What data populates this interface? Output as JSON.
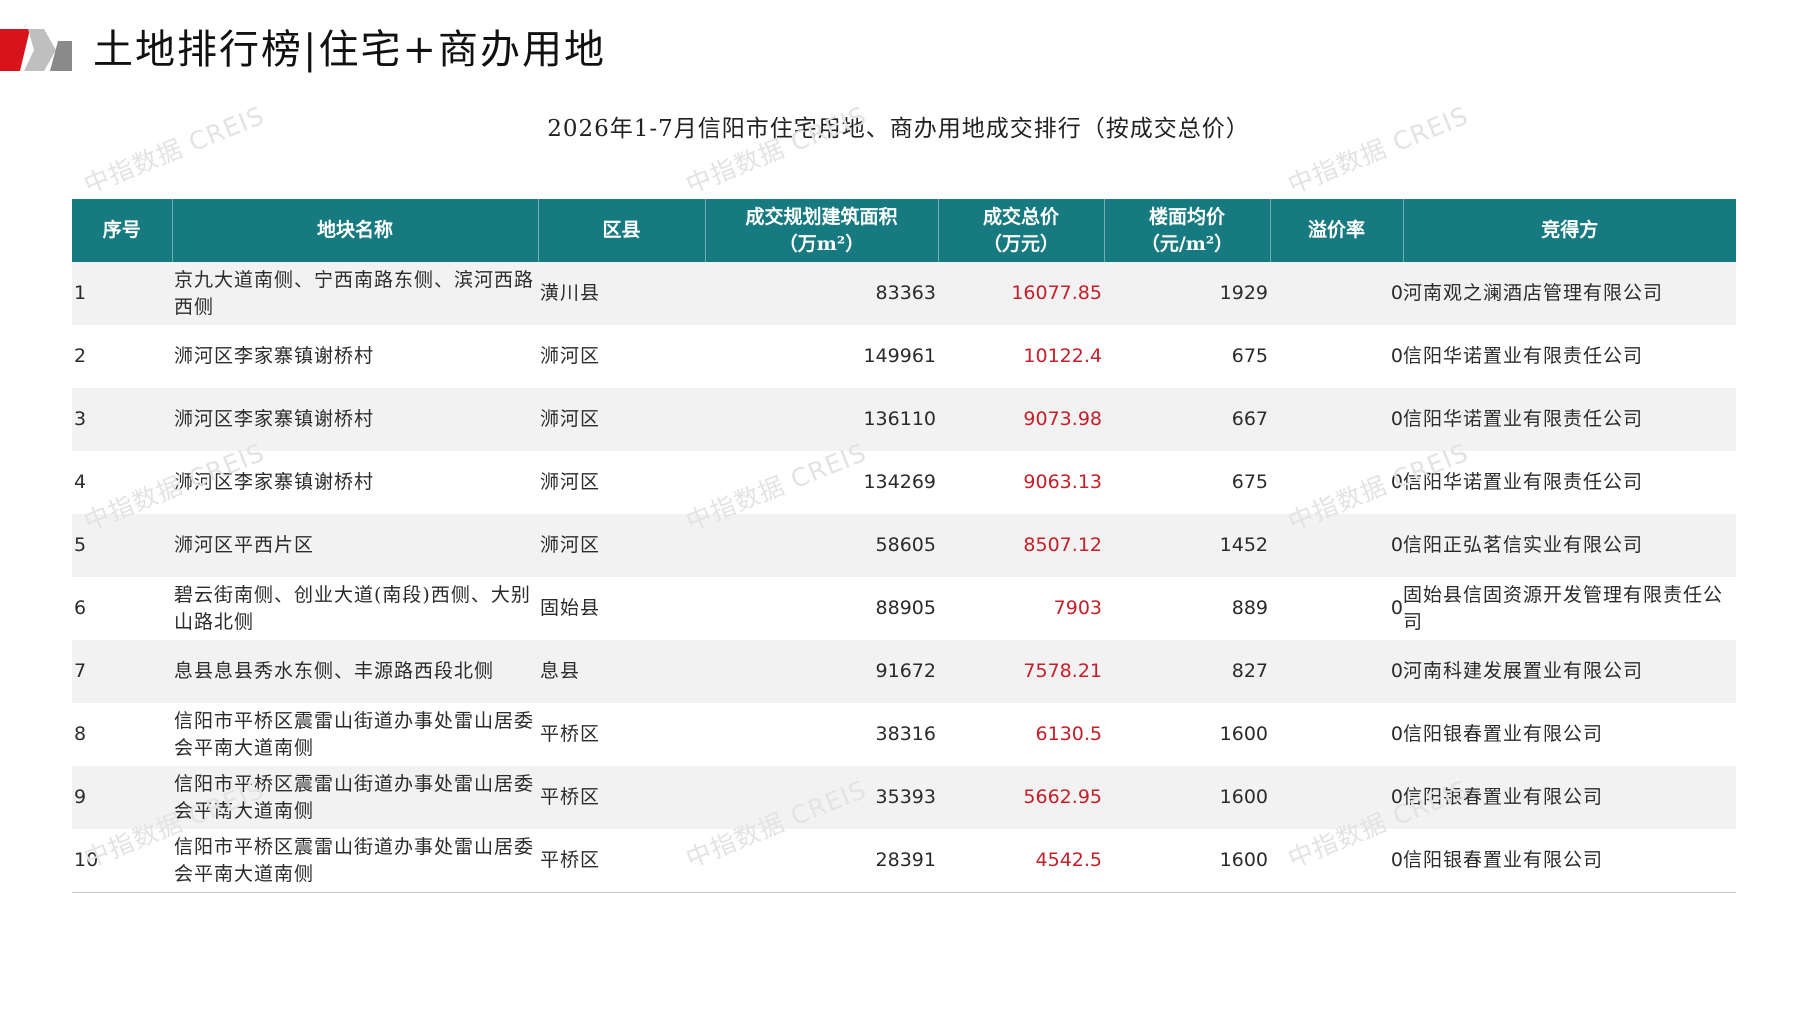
{
  "header": {
    "title": "土地排行榜|住宅+商办用地",
    "subtitle": "2026年1-7月信阳市住宅用地、商办用地成交排行（按成交总价）"
  },
  "watermark": "中指数据 CREIS",
  "table": {
    "columns": [
      {
        "line1": "序号",
        "line2": ""
      },
      {
        "line1": "地块名称",
        "line2": ""
      },
      {
        "line1": "区县",
        "line2": ""
      },
      {
        "line1": "成交规划建筑面积",
        "line2": "（万m²）"
      },
      {
        "line1": "成交总价",
        "line2": "（万元）"
      },
      {
        "line1": "楼面均价",
        "line2": "（元/m²）"
      },
      {
        "line1": "溢价率",
        "line2": ""
      },
      {
        "line1": "竞得方",
        "line2": ""
      }
    ],
    "rows": [
      {
        "no": "1",
        "name": "京九大道南侧、宁西南路东侧、滨河西路西侧",
        "district": "潢川县",
        "area": "83363",
        "total": "16077.85",
        "unit": "1929",
        "premium": "0",
        "buyer": "河南观之澜酒店管理有限公司"
      },
      {
        "no": "2",
        "name": "浉河区李家寨镇谢桥村",
        "district": "浉河区",
        "area": "149961",
        "total": "10122.4",
        "unit": "675",
        "premium": "0",
        "buyer": "信阳华诺置业有限责任公司"
      },
      {
        "no": "3",
        "name": "浉河区李家寨镇谢桥村",
        "district": "浉河区",
        "area": "136110",
        "total": "9073.98",
        "unit": "667",
        "premium": "0",
        "buyer": "信阳华诺置业有限责任公司"
      },
      {
        "no": "4",
        "name": "浉河区李家寨镇谢桥村",
        "district": "浉河区",
        "area": "134269",
        "total": "9063.13",
        "unit": "675",
        "premium": "0",
        "buyer": "信阳华诺置业有限责任公司"
      },
      {
        "no": "5",
        "name": "浉河区平西片区",
        "district": "浉河区",
        "area": "58605",
        "total": "8507.12",
        "unit": "1452",
        "premium": "0",
        "buyer": "信阳正弘茗信实业有限公司"
      },
      {
        "no": "6",
        "name": "碧云街南侧、创业大道(南段)西侧、大别山路北侧",
        "district": "固始县",
        "area": "88905",
        "total": "7903",
        "unit": "889",
        "premium": "0",
        "buyer": "固始县信固资源开发管理有限责任公司"
      },
      {
        "no": "7",
        "name": "息县息县秀水东侧、丰源路西段北侧",
        "district": "息县",
        "area": "91672",
        "total": "7578.21",
        "unit": "827",
        "premium": "0",
        "buyer": "河南科建发展置业有限公司"
      },
      {
        "no": "8",
        "name": "信阳市平桥区震雷山街道办事处雷山居委会平南大道南侧",
        "district": "平桥区",
        "area": "38316",
        "total": "6130.5",
        "unit": "1600",
        "premium": "0",
        "buyer": "信阳银春置业有限公司"
      },
      {
        "no": "9",
        "name": "信阳市平桥区震雷山街道办事处雷山居委会平南大道南侧",
        "district": "平桥区",
        "area": "35393",
        "total": "5662.95",
        "unit": "1600",
        "premium": "0",
        "buyer": "信阳银春置业有限公司"
      },
      {
        "no": "10",
        "name": "信阳市平桥区震雷山街道办事处雷山居委会平南大道南侧",
        "district": "平桥区",
        "area": "28391",
        "total": "4542.5",
        "unit": "1600",
        "premium": "0",
        "buyer": "信阳银春置业有限公司"
      }
    ]
  },
  "colors": {
    "header_bg": "#177a80",
    "price_text": "#c4202a",
    "logo_red": "#d7141c",
    "row_alt": "#f2f2f2"
  }
}
